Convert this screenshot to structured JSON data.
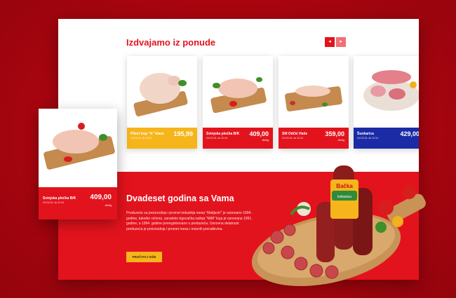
{
  "offers": {
    "title": "Izdvajamo iz ponude",
    "nav_prev": "◂",
    "nav_next": "▸",
    "products": [
      {
        "name": "Pileći trup \"A\" klase",
        "date": "Od 02.04. do 22.04.",
        "price": "195,99",
        "unit": "din/kg",
        "color": "#f6b51b"
      },
      {
        "name": "Svinjska plećka B/K",
        "date": "Od 02.04. do 22.04.",
        "price": "409,00",
        "unit": "din/kg",
        "color": "#e3131d"
      },
      {
        "name": "SM Odčić Haše",
        "date": "Od 02.04. do 22.04.",
        "price": "359,00",
        "unit": "din/kg",
        "color": "#e3131d"
      },
      {
        "name": "Šunkarica",
        "date": "Od 02.04. do 22.04.",
        "price": "429,00",
        "unit": "din/kg",
        "color": "#1b2ba6"
      }
    ]
  },
  "featured": {
    "name": "Svinjska plećka B/K",
    "date": "Od 02.04. do 22.04.",
    "price": "409,00",
    "unit": "din/kg"
  },
  "about": {
    "title": "Dvadeset godina sa Vama",
    "text": "Preduzeće za proizvodnju i promet industrija mesa \"Matijević\" je osnovano 1994. godine, također rečeno, zanatsko trgovačka radnja \"MiM\" koja je osnovana 1991. godine, a 1994. godine preregistrovano u preduzeća. Osnovna delatnost preduzeća je proizvodnja i promet mesa i mesnih prerađevina.",
    "button": "PROČITAJ VIŠE"
  },
  "colors": {
    "brand_red": "#e3131d",
    "accent_yellow": "#f6b51b",
    "accent_blue": "#1b2ba6",
    "backdrop": "#a9050f"
  },
  "product_label": {
    "brand": "Bačka",
    "type": "kobasica"
  }
}
